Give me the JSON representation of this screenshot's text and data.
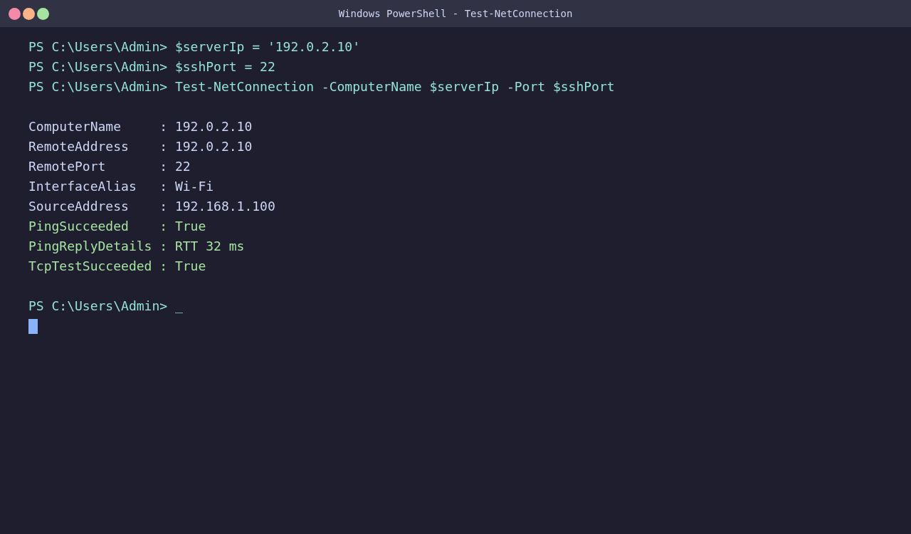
{
  "window": {
    "title": "Windows PowerShell - Test-NetConnection"
  },
  "lines": [
    {
      "kind": "command",
      "text": "PS C:\\Users\\Admin> $serverIp = '192.0.2.10'"
    },
    {
      "kind": "command",
      "text": "PS C:\\Users\\Admin> $sshPort = 22"
    },
    {
      "kind": "command",
      "text": "PS C:\\Users\\Admin> Test-NetConnection -ComputerName $serverIp -Port $sshPort"
    },
    {
      "kind": "blank"
    },
    {
      "kind": "output",
      "text": "ComputerName     : 192.0.2.10"
    },
    {
      "kind": "output",
      "text": "RemoteAddress    : 192.0.2.10"
    },
    {
      "kind": "output",
      "text": "RemotePort       : 22"
    },
    {
      "kind": "output",
      "text": "InterfaceAlias   : Wi-Fi"
    },
    {
      "kind": "output",
      "text": "SourceAddress    : 192.168.1.100"
    },
    {
      "kind": "success",
      "text": "PingSucceeded    : True"
    },
    {
      "kind": "success",
      "text": "PingReplyDetails : RTT 32 ms"
    },
    {
      "kind": "success",
      "text": "TcpTestSucceeded : True"
    },
    {
      "kind": "blank"
    },
    {
      "kind": "command",
      "text": "PS C:\\Users\\Admin> _"
    },
    {
      "kind": "cursor"
    }
  ]
}
